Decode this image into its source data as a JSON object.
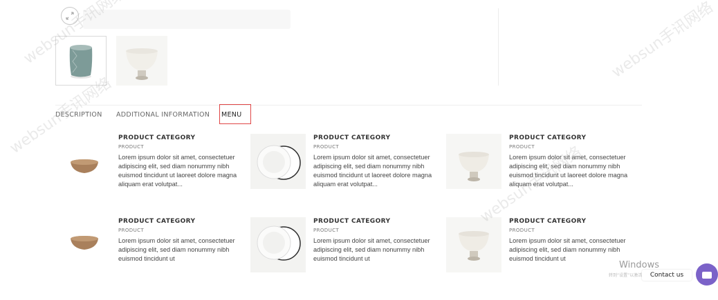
{
  "gallery": {
    "zoom_icon": "expand-icon",
    "thumbnails": [
      {
        "name": "thumbnail-green-cup",
        "color": "#7d9b98"
      },
      {
        "name": "thumbnail-white-bowl",
        "color": "#f1efe9"
      }
    ]
  },
  "tabs": [
    {
      "label": "DESCRIPTION",
      "active": false
    },
    {
      "label": "ADDITIONAL INFORMATION",
      "active": false
    },
    {
      "label": "MENU",
      "active": true
    }
  ],
  "highlight_color": "#e04545",
  "menu_items": [
    {
      "category": "PRODUCT CATEGORY",
      "sub": "PRODUCT",
      "desc": "Lorem ipsum dolor sit amet, consectetuer adipiscing elit, sed diam nonummy nibh euismod tincidunt ut laoreet dolore magna aliquam erat volutpat...",
      "image": "brown-bowl"
    },
    {
      "category": "PRODUCT CATEGORY",
      "sub": "PRODUCT",
      "desc": "Lorem ipsum dolor sit amet, consectetuer adipiscing elit, sed diam nonummy nibh euismod tincidunt ut laoreet dolore magna aliquam erat volutpat...",
      "image": "white-plates"
    },
    {
      "category": "PRODUCT CATEGORY",
      "sub": "PRODUCT",
      "desc": "Lorem ipsum dolor sit amet, consectetuer adipiscing elit, sed diam nonummy nibh euismod tincidunt ut laoreet dolore magna aliquam erat volutpat...",
      "image": "white-footed-bowl"
    },
    {
      "category": "PRODUCT CATEGORY",
      "sub": "PRODUCT",
      "desc": "Lorem ipsum dolor sit amet, consectetuer adipiscing elit, sed diam nonummy nibh euismod tincidunt ut",
      "image": "brown-bowl"
    },
    {
      "category": "PRODUCT CATEGORY",
      "sub": "PRODUCT",
      "desc": "Lorem ipsum dolor sit amet, consectetuer adipiscing elit, sed diam nonummy nibh euismod tincidunt ut",
      "image": "white-plates"
    },
    {
      "category": "PRODUCT CATEGORY",
      "sub": "PRODUCT",
      "desc": "Lorem ipsum dolor sit amet, consectetuer adipiscing elit, sed diam nonummy nibh euismod tincidunt ut",
      "image": "white-footed-bowl"
    }
  ],
  "overlay": {
    "windows_text": "Windows",
    "windows_sub": "转到“设置”以激活Windows。",
    "contact_label": "Contact us",
    "chat_icon": "chat-icon",
    "chat_color": "#7b62c8"
  },
  "watermark": "websun手讯网络"
}
